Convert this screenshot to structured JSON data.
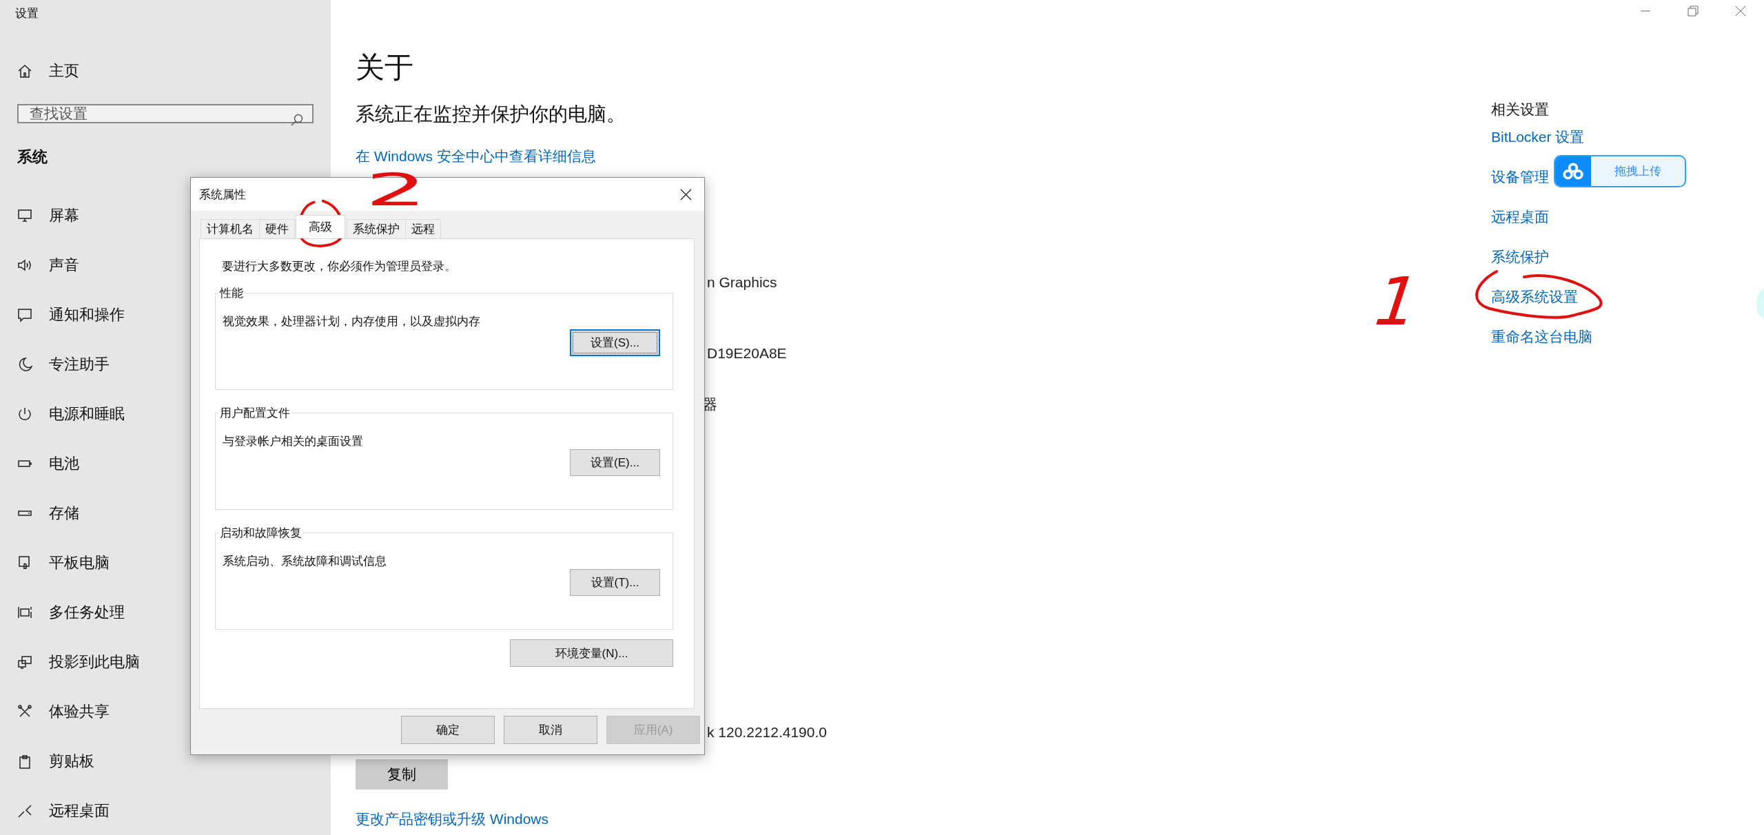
{
  "window": {
    "title": "设置"
  },
  "sidebar": {
    "home": "主页",
    "search": {
      "placeholder": "查找设置"
    },
    "section": "系统",
    "items": [
      {
        "label": "屏幕"
      },
      {
        "label": "声音"
      },
      {
        "label": "通知和操作"
      },
      {
        "label": "专注助手"
      },
      {
        "label": "电源和睡眠"
      },
      {
        "label": "电池"
      },
      {
        "label": "存储"
      },
      {
        "label": "平板电脑"
      },
      {
        "label": "多任务处理"
      },
      {
        "label": "投影到此电脑"
      },
      {
        "label": "体验共享"
      },
      {
        "label": "剪贴板"
      },
      {
        "label": "远程桌面"
      }
    ]
  },
  "main": {
    "title": "关于",
    "security_heading": "系统正在监控并保护你的电脑。",
    "security_link": "在 Windows 安全中心中查看详细信息",
    "spec_fragments": [
      "n Graphics",
      "D19E20A8E",
      "器",
      "k 120.2212.4190.0"
    ],
    "copy_button": "复制",
    "upgrade_link": "更改产品密钥或升级 Windows"
  },
  "related": {
    "heading": "相关设置",
    "links": [
      "BitLocker 设置",
      "设备管理",
      "远程桌面",
      "系统保护",
      "高级系统设置",
      "重命名这台电脑"
    ]
  },
  "upload_widget": {
    "label": "拖拽上传"
  },
  "dialog": {
    "title": "系统属性",
    "tabs": [
      {
        "label": "计算机名",
        "selected": false
      },
      {
        "label": "硬件",
        "selected": false
      },
      {
        "label": "高级",
        "selected": true
      },
      {
        "label": "系统保护",
        "selected": false
      },
      {
        "label": "远程",
        "selected": false
      }
    ],
    "notice": "要进行大多数更改，你必须作为管理员登录。",
    "groups": [
      {
        "title": "性能",
        "description": "视觉效果，处理器计划，内存使用，以及虚拟内存",
        "button": "设置(S)...",
        "focused": true
      },
      {
        "title": "用户配置文件",
        "description": "与登录帐户相关的桌面设置",
        "button": "设置(E)...",
        "focused": false
      },
      {
        "title": "启动和故障恢复",
        "description": "系统启动、系统故障和调试信息",
        "button": "设置(T)...",
        "focused": false
      }
    ],
    "env_button": "环境变量(N)...",
    "buttons": [
      {
        "label": "确定",
        "disabled": false
      },
      {
        "label": "取消",
        "disabled": false
      },
      {
        "label": "应用(A)",
        "disabled": true
      }
    ]
  },
  "annotations": [
    {
      "text": "2"
    },
    {
      "text": "1"
    }
  ]
}
